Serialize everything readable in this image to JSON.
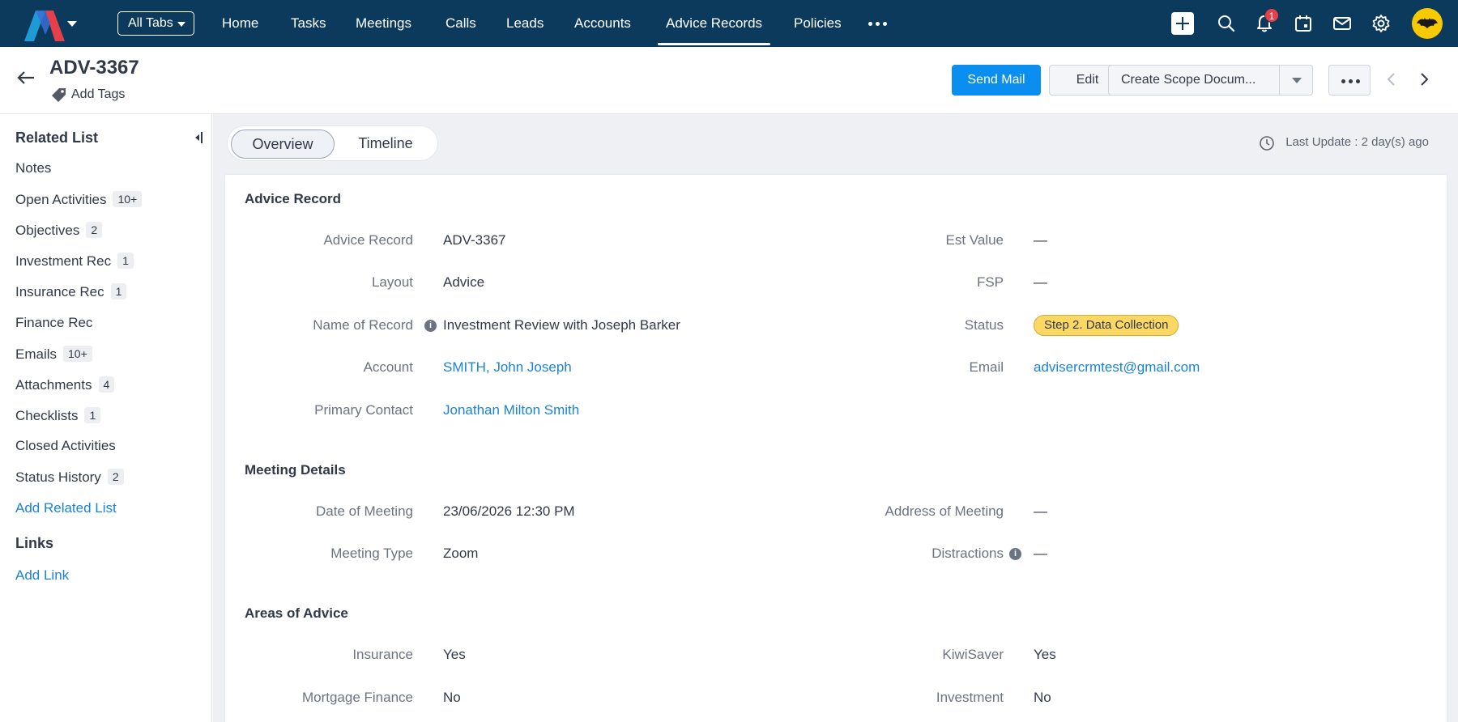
{
  "topnav": {
    "all_tabs_label": "All Tabs",
    "tabs": [
      {
        "label": "Home"
      },
      {
        "label": "Tasks"
      },
      {
        "label": "Meetings"
      },
      {
        "label": "Calls"
      },
      {
        "label": "Leads"
      },
      {
        "label": "Accounts"
      },
      {
        "label": "Advice Records",
        "active": true
      },
      {
        "label": "Policies"
      }
    ],
    "notification_count": "1",
    "icons": [
      "plus-icon",
      "search-icon",
      "bell-icon",
      "calendar-icon",
      "mail-icon",
      "gear-icon",
      "avatar"
    ]
  },
  "header": {
    "record_title": "ADV-3367",
    "add_tags_label": "Add Tags",
    "send_mail_label": "Send Mail",
    "edit_label": "Edit",
    "create_scope_label": "Create Scope Docum..."
  },
  "sidebar": {
    "related_list_heading": "Related List",
    "items": [
      {
        "label": "Notes",
        "badge": ""
      },
      {
        "label": "Open Activities",
        "badge": "10+"
      },
      {
        "label": "Objectives",
        "badge": "2"
      },
      {
        "label": "Investment Rec",
        "badge": "1"
      },
      {
        "label": "Insurance Rec",
        "badge": "1"
      },
      {
        "label": "Finance Rec",
        "badge": ""
      },
      {
        "label": "Emails",
        "badge": "10+"
      },
      {
        "label": "Attachments",
        "badge": "4"
      },
      {
        "label": "Checklists",
        "badge": "1"
      },
      {
        "label": "Closed Activities",
        "badge": ""
      },
      {
        "label": "Status History",
        "badge": "2"
      }
    ],
    "add_related_list_label": "Add Related List",
    "links_heading": "Links",
    "add_link_label": "Add Link"
  },
  "main": {
    "tabs": {
      "overview": "Overview",
      "timeline": "Timeline"
    },
    "last_update": "Last Update : 2 day(s) ago",
    "sections": {
      "advice_record": {
        "title": "Advice Record",
        "advice_record_label": "Advice Record",
        "advice_record_value": "ADV-3367",
        "layout_label": "Layout",
        "layout_value": "Advice",
        "name_label": "Name of Record",
        "name_value": "Investment Review with Joseph Barker",
        "account_label": "Account",
        "account_value": "SMITH, John Joseph",
        "primary_contact_label": "Primary Contact",
        "primary_contact_value": "Jonathan Milton Smith",
        "est_value_label": "Est Value",
        "est_value_value": "—",
        "fsp_label": "FSP",
        "fsp_value": "—",
        "status_label": "Status",
        "status_value": "Step 2. Data Collection",
        "email_label": "Email",
        "email_value": "advisercrmtest@gmail.com"
      },
      "meeting_details": {
        "title": "Meeting Details",
        "date_label": "Date of Meeting",
        "date_value": "23/06/2026 12:30 PM",
        "type_label": "Meeting Type",
        "type_value": "Zoom",
        "address_label": "Address of Meeting",
        "address_value": "—",
        "distractions_label": "Distractions",
        "distractions_value": "—"
      },
      "areas_of_advice": {
        "title": "Areas of Advice",
        "insurance_label": "Insurance",
        "insurance_value": "Yes",
        "mortgage_label": "Mortgage Finance",
        "mortgage_value": "No",
        "kiwisaver_label": "KiwiSaver",
        "kiwisaver_value": "Yes",
        "investment_label": "Investment",
        "investment_value": "No"
      }
    }
  },
  "colors": {
    "nav_bg": "#0b3a5c",
    "primary_button": "#0a8ef0",
    "link": "#1a83d4",
    "status_badge": "#fbd763"
  }
}
